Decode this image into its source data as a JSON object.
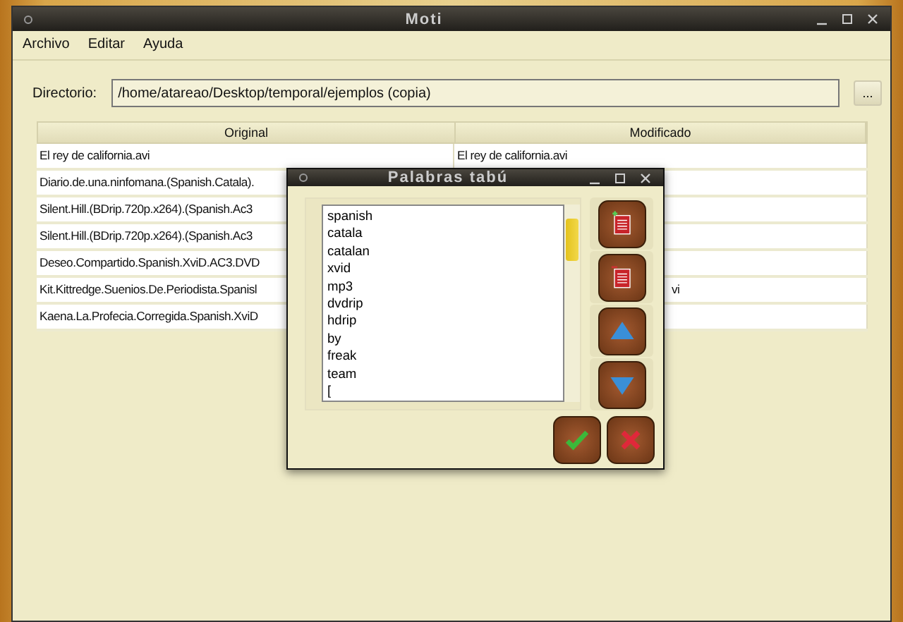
{
  "window": {
    "title": "Moti"
  },
  "menu": [
    "Archivo",
    "Editar",
    "Ayuda"
  ],
  "directory": {
    "label": "Directorio:",
    "value": "/home/atareao/Desktop/temporal/ejemplos (copia)",
    "browse_button": "..."
  },
  "table": {
    "columns": [
      "Original",
      "Modificado"
    ],
    "rows": [
      {
        "original": "El rey de california.avi",
        "modified": "El rey de california.avi"
      },
      {
        "original": "Diario.de.una.ninfomana.(Spanish.Catala)."
      },
      {
        "original": "Silent.Hill.(BDrip.720p.x264).(Spanish.Ac3"
      },
      {
        "original": "Silent.Hill.(BDrip.720p.x264).(Spanish.Ac3"
      },
      {
        "original": "Deseo.Compartido.Spanish.XviD.AC3.DVD"
      },
      {
        "original": "Kit.Kittredge.Suenios.De.Periodista.Spanisl",
        "modified": "vi"
      },
      {
        "original": "Kaena.La.Profecia.Corregida.Spanish.XviD"
      }
    ]
  },
  "dialog": {
    "title": "Palabras tabú",
    "words": [
      "spanish",
      "catala",
      "catalan",
      "xvid",
      "mp3",
      "dvdrip",
      "hdrip",
      "by",
      "freak",
      "team",
      "["
    ],
    "side_buttons": [
      {
        "kind": "add"
      },
      {
        "kind": "remove"
      },
      {
        "kind": "up"
      },
      {
        "kind": "down"
      }
    ],
    "footer_buttons": [
      {
        "kind": "accept"
      },
      {
        "kind": "cancel"
      }
    ]
  }
}
